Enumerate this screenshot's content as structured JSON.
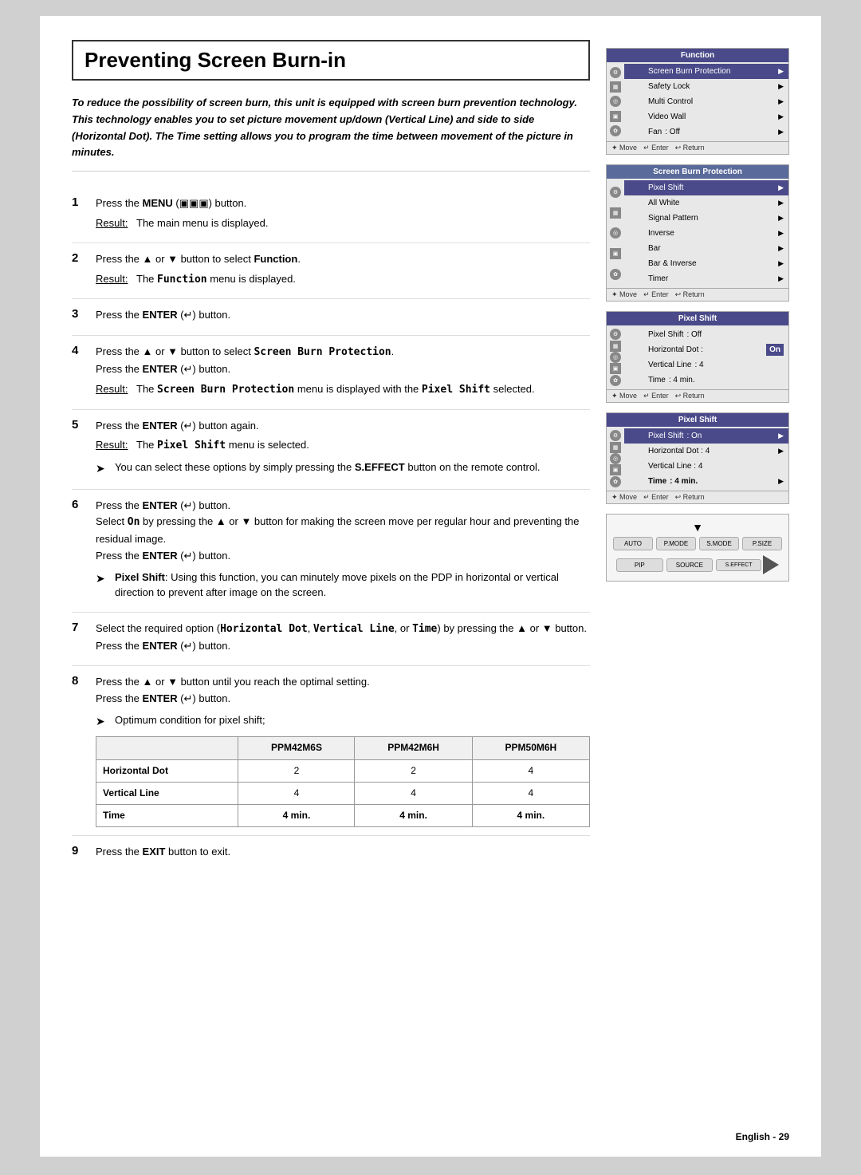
{
  "page": {
    "title": "Preventing Screen Burn-in",
    "footer": "English - 29"
  },
  "intro": "To reduce the possibility of screen burn, this unit is equipped with screen burn prevention technology. This technology enables you to set picture movement up/down (Vertical Line) and side to side (Horizontal Dot). The Time setting allows you to program the time between movement of the picture in minutes.",
  "steps": [
    {
      "number": "1",
      "action": "Press the MENU (□□□) button.",
      "result_label": "Result:",
      "result_text": "The main menu is displayed."
    },
    {
      "number": "2",
      "action": "Press the ▲ or ▼ button to select Function.",
      "result_label": "Result:",
      "result_text": "The Function menu is displayed."
    },
    {
      "number": "3",
      "action": "Press the ENTER (↵) button.",
      "result_label": null
    },
    {
      "number": "4",
      "action": "Press the ▲ or ▼ button to select Screen Burn Protection. Press the ENTER (↵) button.",
      "result_label": "Result:",
      "result_text": "The Screen Burn Protection menu is displayed with the Pixel Shift selected."
    },
    {
      "number": "5",
      "action": "Press the ENTER (↵) button again.",
      "result_label": "Result:",
      "result_text": "The Pixel Shift menu is selected.",
      "note": "You can select these options by simply pressing the S.EFFECT button on the remote control."
    },
    {
      "number": "6",
      "action": "Press the ENTER (↵) button.",
      "action2": "Select On by pressing the ▲ or ▼ button for making the screen move per regular hour and preventing the residual image. Press the ENTER (↵) button.",
      "note": "Pixel Shift: Using this function, you can minutely move pixels on the PDP in horizontal or vertical direction to prevent after image on the screen."
    },
    {
      "number": "7",
      "action": "Select the required option (Horizontal Dot, Vertical Line, or Time) by pressing the ▲ or ▼ button. Press the ENTER (↵) button."
    },
    {
      "number": "8",
      "action": "Press the ▲ or ▼ button until you reach the optimal setting. Press the ENTER (↵) button.",
      "note": "Optimum condition for pixel shift;"
    },
    {
      "number": "9",
      "action": "Press the EXIT button to exit."
    }
  ],
  "table": {
    "headers": [
      "",
      "PPM42M6S",
      "PPM42M6H",
      "PPM50M6H"
    ],
    "rows": [
      {
        "label": "Horizontal Dot",
        "vals": [
          "2",
          "2",
          "4"
        ]
      },
      {
        "label": "Vertical Line",
        "vals": [
          "4",
          "4",
          "4"
        ]
      },
      {
        "label": "Time",
        "vals": [
          "4 min.",
          "4 min.",
          "4 min."
        ]
      }
    ]
  },
  "menus": [
    {
      "title": "Function",
      "items": [
        {
          "text": "Screen Burn Protection",
          "highlight": true,
          "arrow": true
        },
        {
          "text": "Safety Lock",
          "arrow": true
        },
        {
          "text": "Multi Control",
          "arrow": true
        },
        {
          "text": "Video Wall",
          "arrow": true
        },
        {
          "text": "Fan",
          "value": ": Off",
          "arrow": true
        }
      ]
    },
    {
      "title": "Screen Burn Protection",
      "items": [
        {
          "text": "Pixel Shift",
          "highlight": true,
          "arrow": true
        },
        {
          "text": "All White",
          "arrow": true
        },
        {
          "text": "Signal Pattern",
          "arrow": true
        },
        {
          "text": "Inverse",
          "arrow": true
        },
        {
          "text": "Bar",
          "arrow": true
        },
        {
          "text": "Bar & Inverse",
          "arrow": true
        },
        {
          "text": "Timer",
          "arrow": true
        }
      ]
    },
    {
      "title": "Pixel Shift",
      "items": [
        {
          "text": "Pixel Shift",
          "value": ": Off",
          "arrow": false
        },
        {
          "text": "Horizontal Dot :",
          "value": "On",
          "highlight": false,
          "on_highlight": true,
          "arrow": false
        },
        {
          "text": "Vertical Line",
          "value": ": 4",
          "arrow": false
        },
        {
          "text": "Time",
          "value": ": 4 min.",
          "arrow": false
        }
      ]
    },
    {
      "title": "Pixel Shift",
      "items": [
        {
          "text": "Pixel Shift",
          "value": ": On",
          "arrow": true,
          "highlight": true
        },
        {
          "text": "Horizontal Dot : 4",
          "arrow": true
        },
        {
          "text": "Vertical Line  : 4",
          "arrow": false
        },
        {
          "text": "Time",
          "value": ": 4 min.",
          "arrow": true,
          "bold": true
        }
      ]
    }
  ],
  "remote": {
    "buttons_row1": [
      "AUTO",
      "P.MODE",
      "S.MODE",
      "P.SIZE"
    ],
    "buttons_row2": [
      "PIP",
      "SOURCE",
      "S.EFFECT",
      ""
    ]
  },
  "footer_text": "English - 29"
}
